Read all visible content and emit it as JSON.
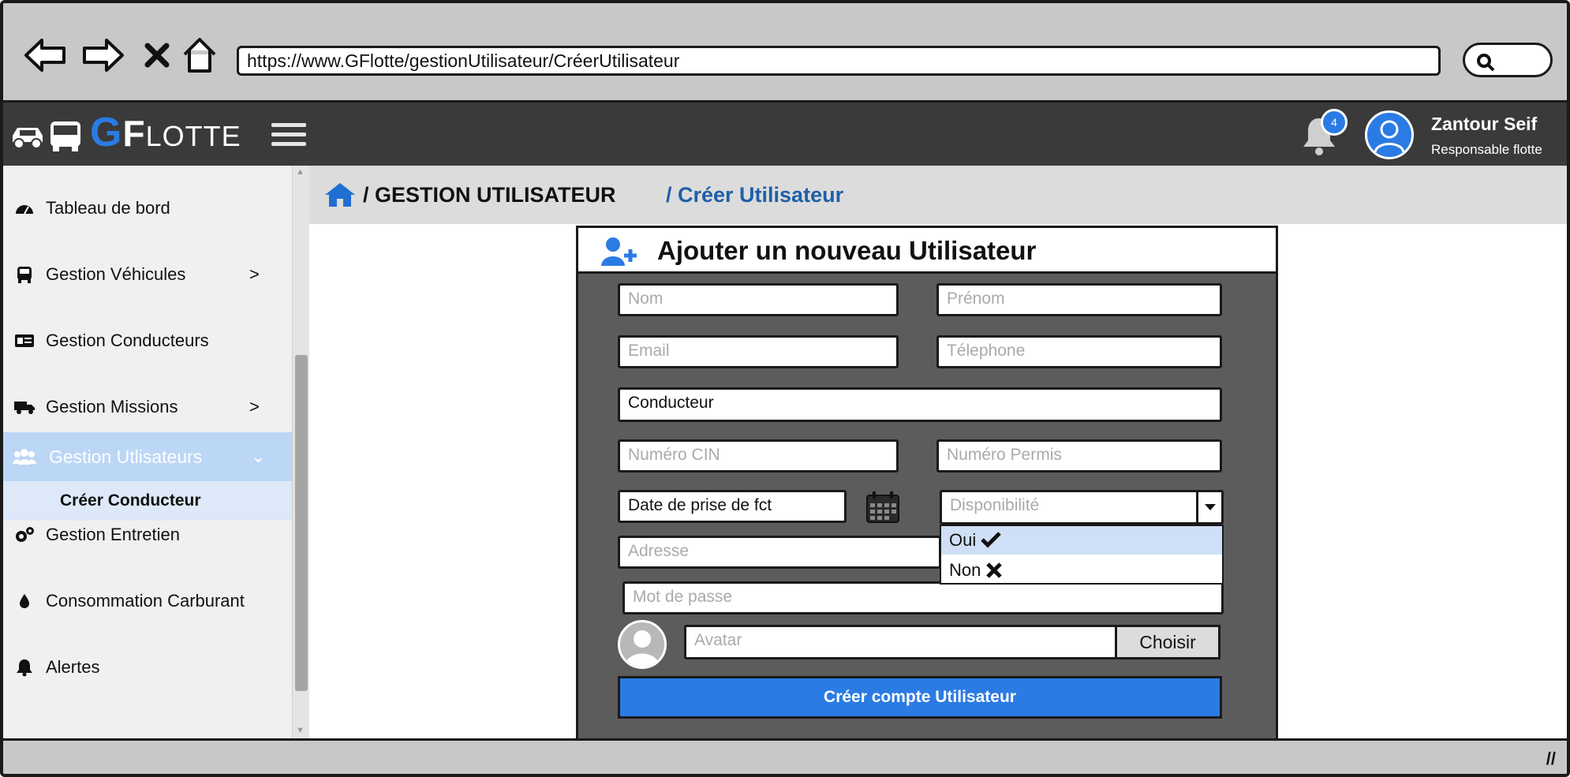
{
  "browser": {
    "url": "https://www.GFlotte/gestionUtilisateur/CréerUtilisateur",
    "nav_icons": [
      "back-arrow-icon",
      "forward-arrow-icon",
      "close-icon",
      "home-icon"
    ],
    "search_icon": "search-icon"
  },
  "header": {
    "logo_g": "G",
    "logo_f": "F",
    "logo_rest": "LOTTE",
    "notification_count": "4",
    "user_name": "Zantour Seif",
    "user_role": "Responsable flotte"
  },
  "sidebar": {
    "items": [
      {
        "label": "Tableau de bord",
        "icon": "dashboard-icon",
        "chevron": ""
      },
      {
        "label": "Gestion Véhicules",
        "icon": "bus-icon",
        "chevron": ">"
      },
      {
        "label": "Gestion Conducteurs",
        "icon": "id-card-icon",
        "chevron": ""
      },
      {
        "label": "Gestion Missions",
        "icon": "truck-icon",
        "chevron": ">"
      },
      {
        "label": "Gestion Utlisateurs",
        "icon": "users-icon",
        "chevron": "⌄"
      },
      {
        "label": "Gestion Entretien",
        "icon": "gears-icon",
        "chevron": ""
      },
      {
        "label": "Consommation Carburant",
        "icon": "fuel-drop-icon",
        "chevron": ""
      },
      {
        "label": "Alertes",
        "icon": "bell-icon",
        "chevron": ""
      }
    ],
    "sub_item": "Créer Conducteur"
  },
  "breadcrumb": {
    "section": "/ GESTION UTILISATEUR",
    "current": "/ Créer Utilisateur"
  },
  "form": {
    "title": "Ajouter un nouveau Utilisateur",
    "nom_placeholder": "Nom",
    "prenom_placeholder": "Prénom",
    "email_placeholder": "Email",
    "telephone_placeholder": "Télephone",
    "role_value": "Conducteur",
    "cin_placeholder": "Numéro CIN",
    "permis_placeholder": "Numéro Permis",
    "date_value": "Date de prise de fct",
    "disponibilite_placeholder": "Disponibilité",
    "disponibilite_options": [
      "Oui",
      "Non"
    ],
    "adresse_placeholder": "Adresse",
    "password_placeholder": "Mot de passe",
    "avatar_placeholder": "Avatar",
    "choose_label": "Choisir",
    "submit_label": "Créer compte Utilisateur"
  },
  "colors": {
    "accent": "#2b7be4",
    "header_bg": "#3a3a3a",
    "panel_bg": "#5c5c5c",
    "active_item": "#bcd6f6",
    "breadcrumb_current": "#1f5fa8"
  }
}
